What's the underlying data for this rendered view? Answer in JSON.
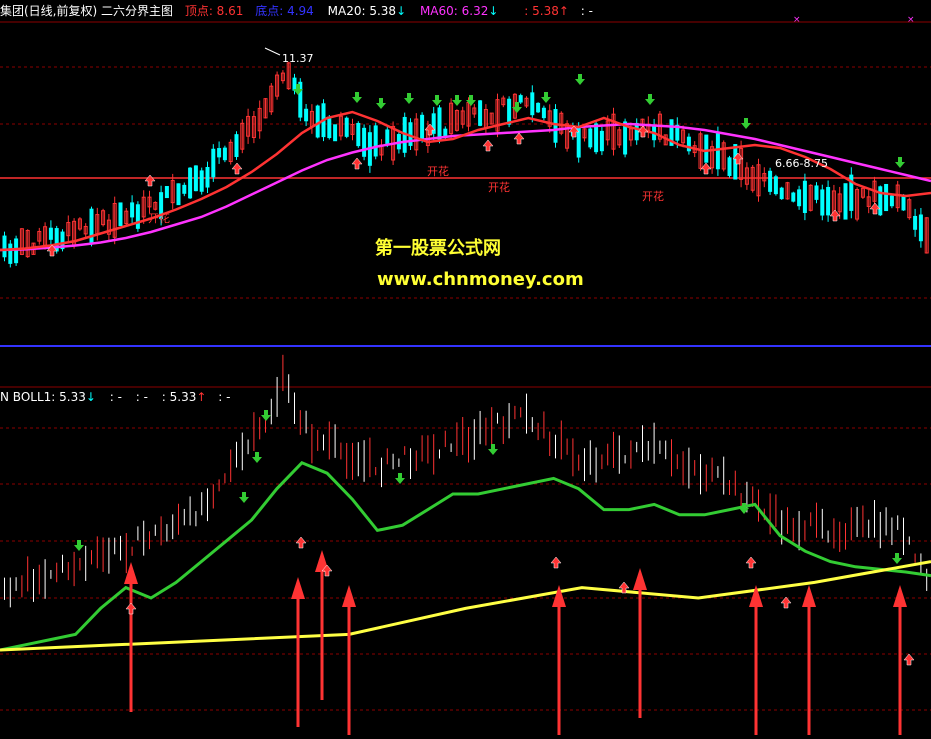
{
  "colors": {
    "bg": "#000000",
    "grid": "#8b0000",
    "red": "#ff3333",
    "blue": "#3333ff",
    "cyan": "#00ffff",
    "magenta": "#ff33ff",
    "green": "#33cc33",
    "yellow": "#ffff44",
    "white": "#ffffff",
    "watermark": "#ffff33"
  },
  "top_header": {
    "title": "集团(日线,前复权) 二六分界主图",
    "high_label": "顶点: 8.61",
    "low_label": "底点: 4.94",
    "ma20_label": "MA20: 5.38",
    "ma20_arrow": "↓",
    "ma60_label": "MA60: 6.32",
    "ma60_arrow": "↓",
    "extra_label": ": 5.38",
    "extra_arrow": "↑",
    "extra_tail": ": -"
  },
  "bottom_header": {
    "boll_label": "N  BOLL1: 5.33",
    "boll_arrow": "↓",
    "sep1": ": -",
    "sep2": ": -",
    "val2": ": 5.33",
    "val2_arrow": "↑",
    "tail": ": -"
  },
  "watermark": {
    "line1": "第一股票公式网",
    "line2": "www.chnmoney.com"
  },
  "top_annotations": [
    {
      "text": "11.37"
    },
    {
      "text": "6.66-8.75"
    },
    {
      "text": "开花"
    },
    {
      "text": "开花"
    },
    {
      "text": "开花"
    },
    {
      "text": "开花"
    }
  ],
  "chart_data": {
    "type": "line",
    "panels": [
      "main",
      "indicator"
    ],
    "main": {
      "series": [
        {
          "name": "MA20",
          "color": "#ff3333",
          "values": [
            4.9,
            4.95,
            5.05,
            5.2,
            5.45,
            5.7,
            5.95,
            6.25,
            6.6,
            7.0,
            7.5,
            8.1,
            8.8,
            9.3,
            9.5,
            9.2,
            8.8,
            8.5,
            8.6,
            8.9,
            9.1,
            9.3,
            9.1,
            9.0,
            9.3,
            9.0,
            8.8,
            8.4,
            8.2,
            8.3,
            8.4,
            8.3,
            8.0,
            7.6,
            7.1,
            6.8,
            6.7,
            6.8
          ]
        },
        {
          "name": "MA60",
          "color": "#ff33ff",
          "values": [
            4.9,
            4.92,
            4.98,
            5.05,
            5.15,
            5.3,
            5.5,
            5.75,
            6.0,
            6.35,
            6.75,
            7.15,
            7.55,
            7.9,
            8.15,
            8.35,
            8.5,
            8.6,
            8.7,
            8.75,
            8.8,
            8.85,
            8.9,
            9.0,
            9.05,
            9.1,
            9.05,
            9.0,
            8.9,
            8.75,
            8.6,
            8.4,
            8.2,
            8.0,
            7.8,
            7.6,
            7.4,
            7.2
          ]
        }
      ],
      "reference_line": 6.66
    },
    "indicator": {
      "series": [
        {
          "name": "BOLL1",
          "values": [
            3.9,
            4.0,
            4.1,
            4.2,
            4.7,
            5.1,
            4.9,
            5.2,
            5.6,
            6.0,
            6.4,
            7.0,
            7.5,
            7.3,
            6.8,
            6.2,
            6.3,
            6.6,
            6.9,
            6.9,
            7.0,
            7.1,
            7.2,
            7.0,
            6.6,
            6.6,
            6.7,
            6.5,
            6.5,
            6.6,
            6.7,
            6.1,
            5.8,
            5.6,
            5.5,
            5.45,
            5.4,
            5.33
          ]
        }
      ]
    }
  }
}
